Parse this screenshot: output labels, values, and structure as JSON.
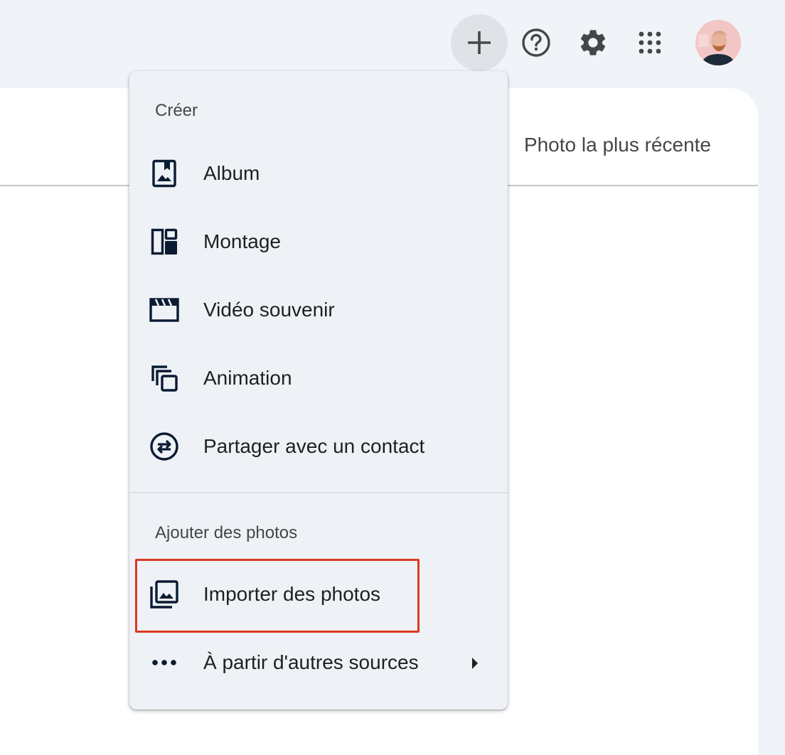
{
  "header": {
    "icons": [
      "plus-icon",
      "help-icon",
      "gear-icon",
      "apps-grid-icon"
    ],
    "avatar": "user-avatar"
  },
  "main": {
    "sort_label": "Photo la plus récente"
  },
  "menu": {
    "create_heading": "Créer",
    "create_items": [
      {
        "label": "Album",
        "icon": "album-icon"
      },
      {
        "label": "Montage",
        "icon": "collage-icon"
      },
      {
        "label": "Vidéo souvenir",
        "icon": "movie-icon"
      },
      {
        "label": "Animation",
        "icon": "animation-icon"
      },
      {
        "label": "Partager avec un contact",
        "icon": "partner-share-icon"
      }
    ],
    "add_heading": "Ajouter des photos",
    "add_items": [
      {
        "label": "Importer des photos",
        "icon": "upload-photos-icon"
      },
      {
        "label": "À partir d'autres sources",
        "icon": "more-horiz-icon"
      }
    ]
  },
  "colors": {
    "accent_highlight": "#d93a1e",
    "icon_color": "#0b1b32",
    "menu_bg": "#eef2f7"
  }
}
